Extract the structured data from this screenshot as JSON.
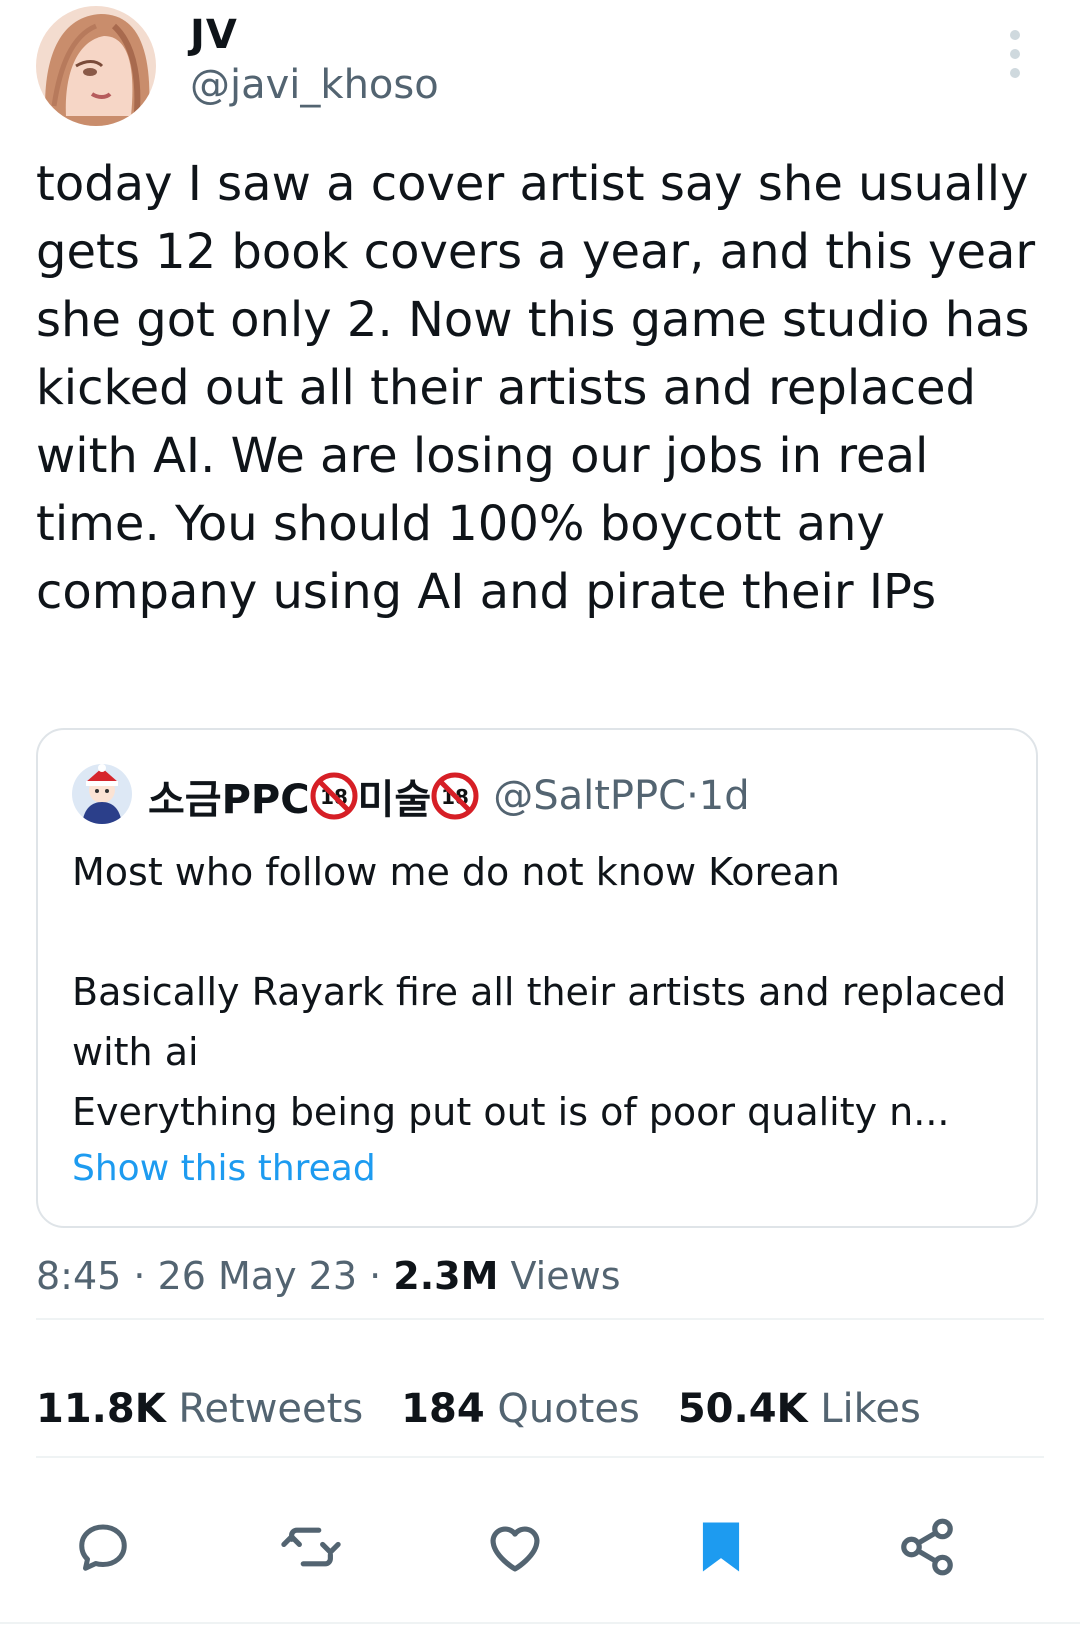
{
  "author": {
    "display_name": "JV",
    "handle": "@javi_khoso"
  },
  "tweet": {
    "text": "today I saw a cover artist say she usually gets 12 book covers a year, and this year she got only 2. Now this game studio has kicked out all their artists and replaced with AI. We are losing our jobs in real time. You should 100% boycott any company using AI and pirate their IPs"
  },
  "quote": {
    "name_prefix": "소금PPC",
    "name_middle": "미술",
    "handle": "@SaltPPC",
    "separator": " · ",
    "age": "1d",
    "line1": "Most who follow me do not know Korean",
    "line2": "Basically Rayark fire all their artists and replaced with ai",
    "line3": "Everything being put out is of poor quality n...",
    "show_thread": "Show this thread"
  },
  "meta": {
    "time": "8:45",
    "date": "26 May 23",
    "views_count": "2.3M",
    "views_label": "Views",
    "sep": " · "
  },
  "stats": {
    "retweets_count": "11.8K",
    "retweets_label": "Retweets",
    "quotes_count": "184",
    "quotes_label": "Quotes",
    "likes_count": "50.4K",
    "likes_label": "Likes"
  },
  "colors": {
    "text": "#0f1419",
    "secondary": "#536471",
    "link": "#1d9bf0",
    "bookmark": "#1d9bf0"
  },
  "icons": {
    "reply": "reply-icon",
    "retweet": "retweet-icon",
    "like": "heart-icon",
    "bookmark": "bookmark-icon",
    "share": "share-icon",
    "more": "more-vertical-icon"
  }
}
